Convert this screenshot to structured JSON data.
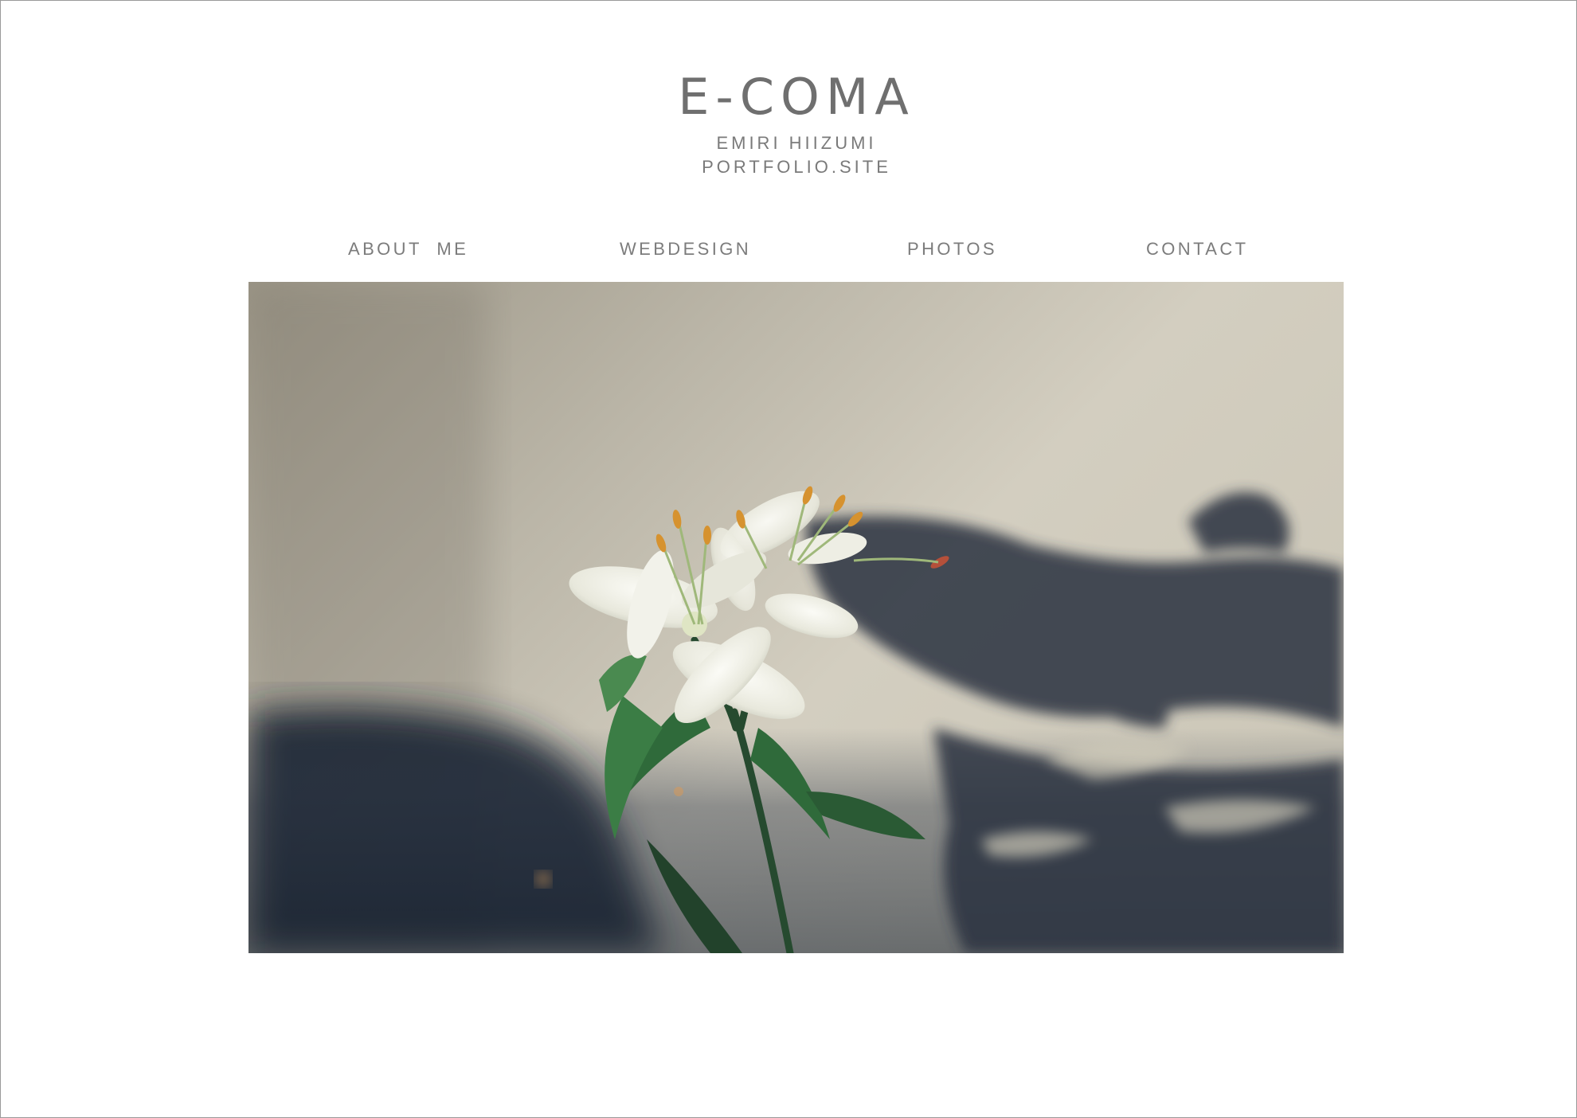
{
  "brand": {
    "title": "E-COMA",
    "name": "EMIRI  HIIZUMI",
    "site": "PORTFOLIO.SITE"
  },
  "nav": {
    "items": [
      {
        "label": "ABOUT  ME"
      },
      {
        "label": "WEBDESIGN"
      },
      {
        "label": "PHOTOS"
      },
      {
        "label": "CONTACT"
      }
    ]
  },
  "hero": {
    "subject": "white lily photograph with shadow on wall"
  },
  "colors": {
    "text": "#6f6f6f",
    "nav_text": "#7c7c7c",
    "frame": "#9a9a9a",
    "shadow": "#1e2a3a",
    "wall": "#cbc6b8"
  }
}
